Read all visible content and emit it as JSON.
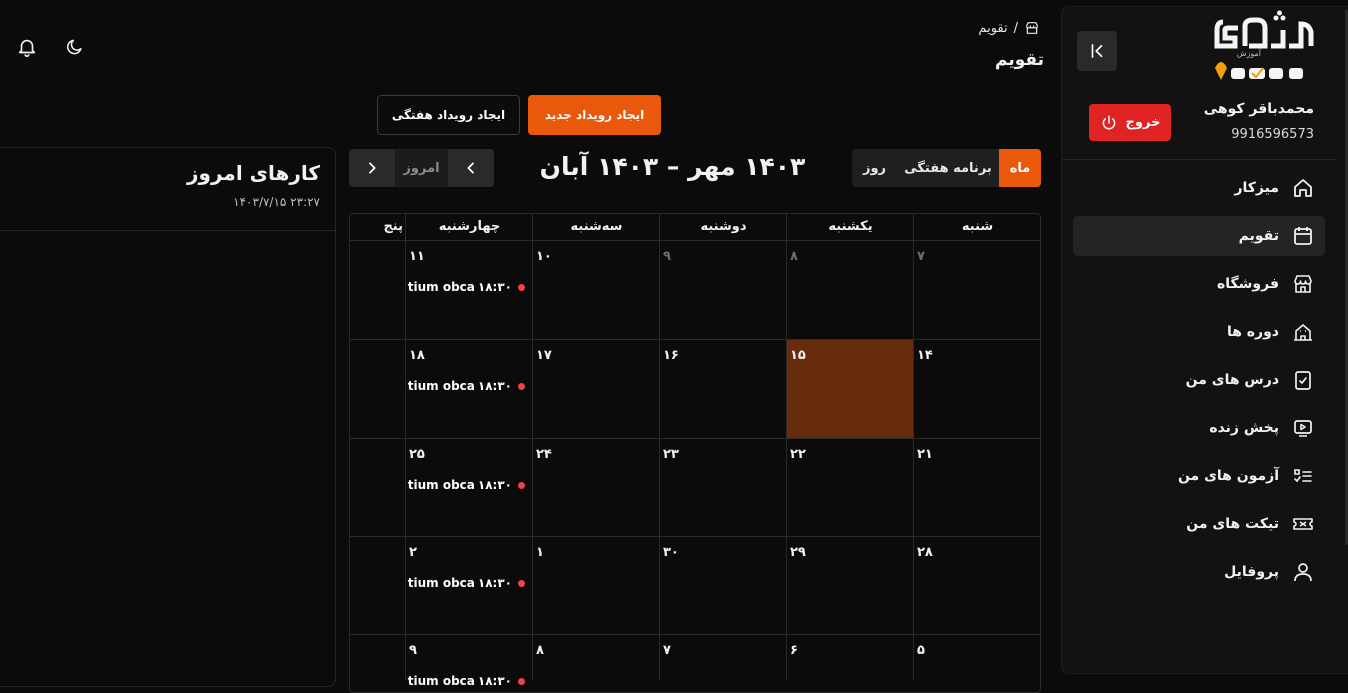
{
  "colors": {
    "accent": "#ea580c",
    "danger": "#e02424",
    "today_cell": "#662c0b",
    "event_dot": "#ef4444"
  },
  "sidebar": {
    "logo_icon": "koshan-logo",
    "collapse_icon": "collapse-left-icon",
    "user_name": "محمدباقر کوهی",
    "user_phone": "9916596573",
    "logout_label": "خروج",
    "items": [
      {
        "label": "میزکار",
        "icon": "home-icon",
        "active": false
      },
      {
        "label": "تقویم",
        "icon": "calendar-icon",
        "active": true
      },
      {
        "label": "فروشگاه",
        "icon": "store-icon",
        "active": false
      },
      {
        "label": "دوره ها",
        "icon": "building-icon",
        "active": false
      },
      {
        "label": "درس های من",
        "icon": "clipboard-check-icon",
        "active": false
      },
      {
        "label": "پخش زنده",
        "icon": "live-icon",
        "active": false
      },
      {
        "label": "آزمون های من",
        "icon": "checklist-icon",
        "active": false
      },
      {
        "label": "تیکت های من",
        "icon": "ticket-icon",
        "active": false
      },
      {
        "label": "پروفایل",
        "icon": "user-icon",
        "active": false
      }
    ]
  },
  "header": {
    "breadcrumb_separator": "/",
    "breadcrumb_current": "تقویم",
    "title": "تقویم"
  },
  "actions": {
    "new_event": "ایجاد رویداد جدید",
    "weekly_event": "ایجاد رویداد هفتگی"
  },
  "today_panel": {
    "title": "کارهای امروز",
    "datetime": "۱۴۰۳/۷/۱۵ ۲۳:۲۷"
  },
  "calendar": {
    "views": [
      "ماه",
      "برنامه هفتگی",
      "روز"
    ],
    "active_view": "ماه",
    "range_title": "۱۴۰۳ مهر – ۱۴۰۳ آبان",
    "today_label": "امروز",
    "weekdays": [
      "شنبه",
      "یکشنبه",
      "دوشنبه",
      "سه‌شنبه",
      "چهارشنبه",
      "پنج"
    ],
    "weeks": [
      [
        "۷",
        "۸",
        "۹",
        "۱۰",
        "۱۱"
      ],
      [
        "۱۴",
        "۱۵",
        "۱۶",
        "۱۷",
        "۱۸"
      ],
      [
        "۲۱",
        "۲۲",
        "۲۳",
        "۲۴",
        "۲۵"
      ],
      [
        "۲۸",
        "۲۹",
        "۳۰",
        "۱",
        "۲"
      ],
      [
        "۵",
        "۶",
        "۷",
        "۸",
        "۹"
      ]
    ],
    "muted_days": [
      "۷",
      "۸",
      "۹"
    ],
    "today_day": "۱۵",
    "event": {
      "time": "۱۸:۳۰",
      "title": "ntium obca"
    }
  }
}
